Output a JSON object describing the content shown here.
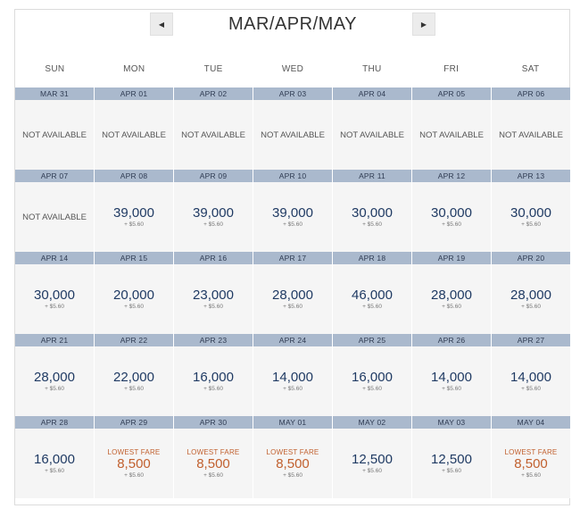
{
  "nav": {
    "prev_icon": "◀",
    "next_icon": "▶",
    "month_label": "MAR/APR/MAY"
  },
  "weekdays": [
    "SUN",
    "MON",
    "TUE",
    "WED",
    "THU",
    "FRI",
    "SAT"
  ],
  "colors": {
    "date_bar": "#aab9cd",
    "price": "#1f3a63",
    "lowest": "#c1602e",
    "cell": "#f5f5f5"
  },
  "weeks": [
    {
      "days": [
        {
          "date": "MAR 31",
          "na": "NOT AVAILABLE"
        },
        {
          "date": "APR 01",
          "na": "NOT AVAILABLE"
        },
        {
          "date": "APR 02",
          "na": "NOT AVAILABLE"
        },
        {
          "date": "APR 03",
          "na": "NOT AVAILABLE"
        },
        {
          "date": "APR 04",
          "na": "NOT AVAILABLE"
        },
        {
          "date": "APR 05",
          "na": "NOT AVAILABLE"
        },
        {
          "date": "APR 06",
          "na": "NOT AVAILABLE"
        }
      ]
    },
    {
      "days": [
        {
          "date": "APR 07",
          "na": "NOT AVAILABLE"
        },
        {
          "date": "APR 08",
          "price": "39,000",
          "tax": "+ $5.60"
        },
        {
          "date": "APR 09",
          "price": "39,000",
          "tax": "+ $5.60"
        },
        {
          "date": "APR 10",
          "price": "39,000",
          "tax": "+ $5.60"
        },
        {
          "date": "APR 11",
          "price": "30,000",
          "tax": "+ $5.60"
        },
        {
          "date": "APR 12",
          "price": "30,000",
          "tax": "+ $5.60"
        },
        {
          "date": "APR 13",
          "price": "30,000",
          "tax": "+ $5.60"
        }
      ]
    },
    {
      "days": [
        {
          "date": "APR 14",
          "price": "30,000",
          "tax": "+ $5.60"
        },
        {
          "date": "APR 15",
          "price": "20,000",
          "tax": "+ $5.60"
        },
        {
          "date": "APR 16",
          "price": "23,000",
          "tax": "+ $5.60"
        },
        {
          "date": "APR 17",
          "price": "28,000",
          "tax": "+ $5.60"
        },
        {
          "date": "APR 18",
          "price": "46,000",
          "tax": "+ $5.60"
        },
        {
          "date": "APR 19",
          "price": "28,000",
          "tax": "+ $5.60"
        },
        {
          "date": "APR 20",
          "price": "28,000",
          "tax": "+ $5.60"
        }
      ]
    },
    {
      "days": [
        {
          "date": "APR 21",
          "price": "28,000",
          "tax": "+ $5.60"
        },
        {
          "date": "APR 22",
          "price": "22,000",
          "tax": "+ $5.60"
        },
        {
          "date": "APR 23",
          "price": "16,000",
          "tax": "+ $5.60"
        },
        {
          "date": "APR 24",
          "price": "14,000",
          "tax": "+ $5.60"
        },
        {
          "date": "APR 25",
          "price": "16,000",
          "tax": "+ $5.60"
        },
        {
          "date": "APR 26",
          "price": "14,000",
          "tax": "+ $5.60"
        },
        {
          "date": "APR 27",
          "price": "14,000",
          "tax": "+ $5.60"
        }
      ]
    },
    {
      "days": [
        {
          "date": "APR 28",
          "price": "16,000",
          "tax": "+ $5.60"
        },
        {
          "date": "APR 29",
          "tag": "LOWEST FARE",
          "price": "8,500",
          "tax": "+ $5.60"
        },
        {
          "date": "APR 30",
          "tag": "LOWEST FARE",
          "price": "8,500",
          "tax": "+ $5.60"
        },
        {
          "date": "MAY 01",
          "tag": "LOWEST FARE",
          "price": "8,500",
          "tax": "+ $5.60"
        },
        {
          "date": "MAY 02",
          "price": "12,500",
          "tax": "+ $5.60"
        },
        {
          "date": "MAY 03",
          "price": "12,500",
          "tax": "+ $5.60"
        },
        {
          "date": "MAY 04",
          "tag": "LOWEST FARE",
          "price": "8,500",
          "tax": "+ $5.60"
        }
      ]
    }
  ]
}
